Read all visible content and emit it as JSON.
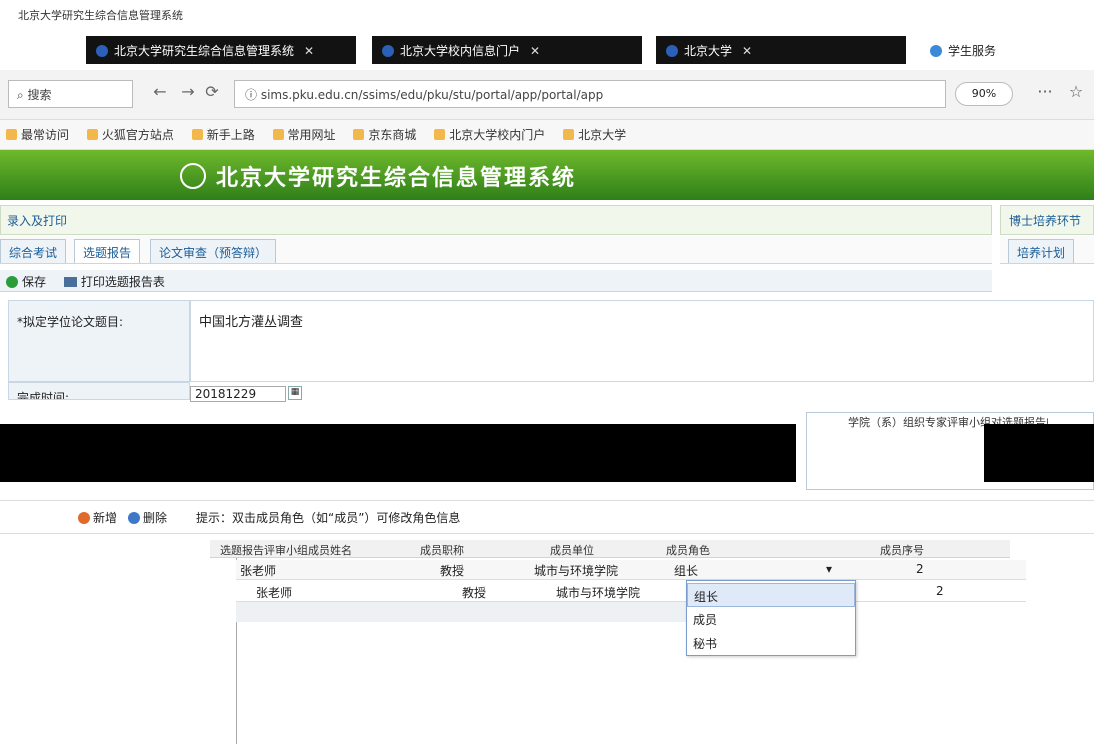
{
  "window": {
    "title": "北京大学研究生综合信息管理系统"
  },
  "browser_tabs": [
    {
      "label": "北京大学研究生综合信息管理系统",
      "close": "✕"
    },
    {
      "label": "北京大学校内信息门户",
      "close": "✕"
    },
    {
      "label": "北京大学",
      "close": "✕"
    },
    {
      "label": "学生服务"
    }
  ],
  "nav": {
    "search_label": "搜索",
    "url": "sims.pku.edu.cn/ssims/edu/pku/stu/portal/app/portal/app",
    "zoom": "90%",
    "more": "···",
    "star": "☆"
  },
  "bookmarks": [
    "最常访问",
    "火狐官方站点",
    "新手上路",
    "常用网址",
    "京东商城",
    "北京大学校内门户",
    "北京大学"
  ],
  "banner": {
    "title": "北京大学研究生综合信息管理系统"
  },
  "panel": {
    "header": "录入及打印",
    "header_right": "博士培养环节",
    "subtabs": [
      "综合考试",
      "选题报告",
      "论文审查（预答辩）"
    ],
    "subtab_right": "培养计划"
  },
  "toolbar": {
    "save": "保存",
    "print": "打印选题报告表"
  },
  "form": {
    "title_label": "*拟定学位论文题目:",
    "title_value": "中国北方灌丛调查",
    "date_label": "完成时间:",
    "date_value": "20181229",
    "side_label": "学院（系）组织专家评审小组对选题报告的意见"
  },
  "actions": {
    "add": "新增",
    "delete": "删除",
    "hint": "提示：双击成员角色（如“成员”）可修改角色信息"
  },
  "grid": {
    "headers": [
      "选题报告评审小组成员姓名",
      "成员职称",
      "成员单位",
      "成员角色",
      "成员序号"
    ],
    "edit_row": {
      "name": "张老师",
      "title": "教授",
      "unit": "城市与环境学院",
      "role": "组长",
      "order": "2"
    },
    "row": {
      "name": "张老师",
      "title": "教授",
      "unit": "城市与环境学院",
      "order": "2"
    }
  },
  "role_options": [
    "组长",
    "成员",
    "秘书"
  ],
  "colors": {
    "banner_green": "#4c9f24",
    "link_blue": "#1a5c96",
    "selected_option": "#dfe9f7"
  }
}
